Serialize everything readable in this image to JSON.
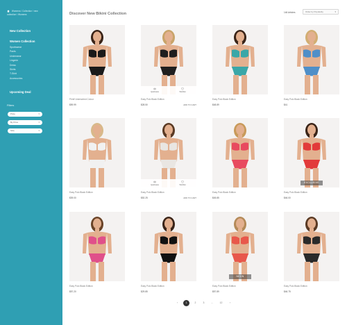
{
  "breadcrumb": {
    "items": [
      "Womens",
      "Collection",
      "new",
      "collection",
      "Womens"
    ]
  },
  "sidebar": {
    "categories": [
      {
        "label": "New Collection"
      },
      {
        "label": "Women Collection"
      }
    ],
    "sub_items": [
      "Sportswear",
      "Pants",
      "Underwear",
      "Lingerie",
      "Dress",
      "Skirts",
      "T-Shirt",
      "Accessories"
    ],
    "upcoming_label": "Upcoming Deal",
    "filters_title": "Filters",
    "filters": [
      "Price",
      "By Price",
      "Size"
    ]
  },
  "header": {
    "title": "Discover New Bikini Collection",
    "count": "146 Articles",
    "sort": "Order by Popularity"
  },
  "overlay": {
    "quickview": "Quickview",
    "wishlist": "Wishlist"
  },
  "products": [
    {
      "name": "Printf Underwired Colour",
      "price": "$59.99",
      "cart": "",
      "overlay": false,
      "badge": ""
    },
    {
      "name": "Easy Polo Black Edition",
      "price": "$28.50",
      "cart": "ADD TO CART",
      "overlay": true,
      "badge": ""
    },
    {
      "name": "Easy Polo Black Edition",
      "price": "$48.89",
      "cart": "",
      "overlay": false,
      "badge": ""
    },
    {
      "name": "Easy Polo Black Edition",
      "price": "$41",
      "cart": "",
      "overlay": false,
      "badge": ""
    },
    {
      "name": "Easy Polo Black Edition",
      "price": "$39.00",
      "cart": "",
      "overlay": false,
      "badge": ""
    },
    {
      "name": "Easy Polo Black Edition",
      "price": "$52.25",
      "cart": "ADD TO CART",
      "overlay": true,
      "badge": ""
    },
    {
      "name": "Easy Polo Black Edition",
      "price": "$45.85",
      "cart": "",
      "overlay": false,
      "badge": ""
    },
    {
      "name": "Easy Polo Black Edition",
      "price": "$46.00",
      "cart": "",
      "overlay": false,
      "badge": "EXCLUSIVE"
    },
    {
      "name": "Easy Polo Black Edition",
      "price": "$57.20",
      "cart": "",
      "overlay": false,
      "badge": ""
    },
    {
      "name": "Easy Polo Black Edition",
      "price": "$29.85",
      "cart": "",
      "overlay": false,
      "badge": ""
    },
    {
      "name": "Easy Polo Black Edition",
      "price": "$57.89",
      "cart": "",
      "overlay": false,
      "badge": "NEON"
    },
    {
      "name": "Easy Polo Black Edition",
      "price": "$46.75",
      "cart": "",
      "overlay": false,
      "badge": ""
    }
  ],
  "pagination": {
    "prev": "‹",
    "pages": [
      "1",
      "2",
      "3",
      "...",
      "12"
    ],
    "next": "›",
    "active": "1"
  },
  "colors": {
    "sidebar": "#2f9fb3",
    "accent": "#333333"
  }
}
